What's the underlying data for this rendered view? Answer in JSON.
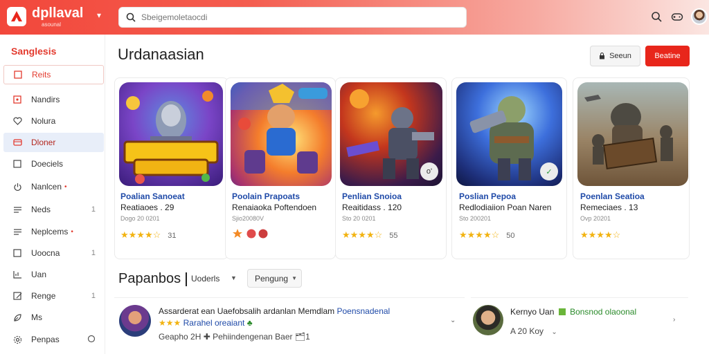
{
  "header": {
    "app_name": "dpllaval",
    "app_tagline": "asounal",
    "search_placeholder": "Sbeigemoletaocdi"
  },
  "sidebar": {
    "title": "Sanglesis",
    "items": [
      {
        "label": "Reits",
        "icon": "square-icon"
      },
      {
        "label": "Nandirs",
        "icon": "square-dot-icon"
      },
      {
        "label": "Nolura",
        "icon": "heart-icon"
      },
      {
        "label": "Dloner",
        "icon": "folder-icon"
      },
      {
        "label": "Doeciels",
        "icon": "square-icon"
      },
      {
        "label": "Nanlcen",
        "icon": "power-icon",
        "dot": "•"
      },
      {
        "label": "Neds",
        "icon": "list-icon",
        "count": "1"
      },
      {
        "label": "Neplcems",
        "icon": "list-icon",
        "dot": "•"
      },
      {
        "label": "Uoocna",
        "icon": "square-icon",
        "count": "1"
      },
      {
        "label": "Uan",
        "icon": "chart-icon"
      },
      {
        "label": "Renge",
        "icon": "edit-icon",
        "count": "1"
      },
      {
        "label": "Ms",
        "icon": "leaf-icon"
      },
      {
        "label": "Penpas",
        "icon": "gear-icon"
      }
    ]
  },
  "main": {
    "title": "Urdanaasian",
    "secondary_button": "Seeun",
    "primary_button": "Beatine",
    "cards": [
      {
        "title": "Poalian Sanoeat",
        "subtitle": "Reatiaoes . 29",
        "meta": "Dogo 20 0201",
        "stars": "★★★★☆",
        "score": "31",
        "badge": ""
      },
      {
        "title": "Poolain Prapoats",
        "subtitle": "Renaiaoka Poftendoen",
        "meta": "Sjio20080V",
        "stars": "",
        "score": "",
        "badge": ""
      },
      {
        "title": "Penlian Snoioa",
        "subtitle": "Reaitidass . 120",
        "meta": "Sto 20 0201",
        "stars": "★★★★☆",
        "score": "55",
        "badge": "o'"
      },
      {
        "title": "Poslian Pepoa",
        "subtitle": "Redlodiaiion Poan Naren",
        "meta": "Sto 200201",
        "stars": "★★★★☆",
        "score": "50",
        "badge": "✓"
      },
      {
        "title": "Poenlan Seatioa",
        "subtitle": "Remeciaes . 13",
        "meta": "Ovp 20201",
        "stars": "★★★★☆",
        "score": "",
        "badge": ""
      }
    ],
    "section": {
      "title": "Papanbos",
      "filter": "Uoderls",
      "dropdown": "Pengung"
    },
    "rows": [
      {
        "title": "Assarderat ean Uaefobsalih ardanlan Memdlam",
        "title_link": "Poensnadenal",
        "stars": "★★★",
        "rating_text": "Rarahel oreaiant",
        "meta": "Geapho 2H ✚ Pehiindengenan Baer 🗂1"
      },
      {
        "title": "Kernyo Uan",
        "title_link": "Bonsnod olaoonal",
        "meta": "A 20 Koy"
      }
    ]
  }
}
